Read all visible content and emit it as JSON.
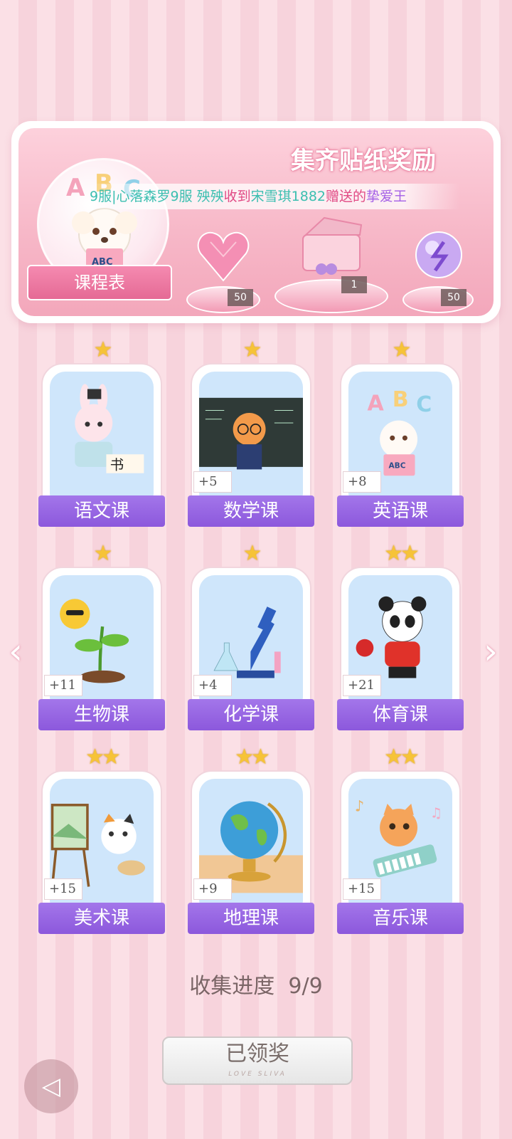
{
  "banner": {
    "title": "集齐贴纸奖励",
    "marquee": {
      "part1": "9服|心落森罗9服 殃殃",
      "part2": "收到",
      "part3": "宋雪琪1882",
      "part4": "赠送的",
      "part5": "挚爱王"
    },
    "schedule_label": "课程表",
    "rewards": [
      {
        "icon": "heart-gem-icon",
        "count": "50"
      },
      {
        "icon": "gift-box-icon",
        "count": "1"
      },
      {
        "icon": "crystal-orb-icon",
        "count": "50"
      }
    ]
  },
  "courses": [
    {
      "label": "语文课",
      "stars": 1,
      "badge": "",
      "icon": "bunny-calligraphy-icon"
    },
    {
      "label": "数学课",
      "stars": 1,
      "badge": "+5",
      "icon": "fox-teacher-icon"
    },
    {
      "label": "英语课",
      "stars": 1,
      "badge": "+8",
      "icon": "puppy-abc-icon"
    },
    {
      "label": "生物课",
      "stars": 1,
      "badge": "+11",
      "icon": "sprout-sun-icon"
    },
    {
      "label": "化学课",
      "stars": 1,
      "badge": "+4",
      "icon": "microscope-icon"
    },
    {
      "label": "体育课",
      "stars": 2,
      "badge": "+21",
      "icon": "panda-pingpong-icon"
    },
    {
      "label": "美术课",
      "stars": 2,
      "badge": "+15",
      "icon": "cat-painter-icon"
    },
    {
      "label": "地理课",
      "stars": 2,
      "badge": "+9",
      "icon": "globe-icon"
    },
    {
      "label": "音乐课",
      "stars": 2,
      "badge": "+15",
      "icon": "cat-keyboard-icon"
    }
  ],
  "progress": {
    "label": "收集进度",
    "value": "9/9"
  },
  "claim": {
    "label": "已领奖",
    "sub": "LOVE SLIVA"
  },
  "colors": {
    "accent_purple": "#8c58dc",
    "pink_bg": "#fbe0e6",
    "star": "#f6c338"
  }
}
